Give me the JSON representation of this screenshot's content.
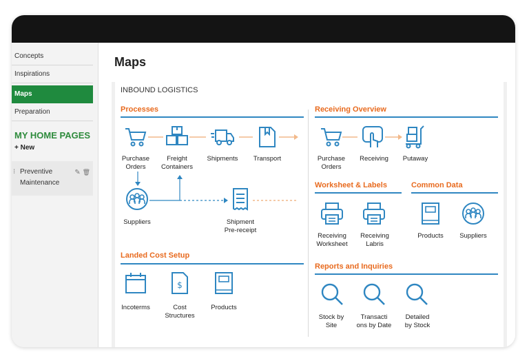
{
  "sidebar": {
    "items": [
      {
        "label": "Concepts"
      },
      {
        "label": "Inspirations"
      },
      {
        "label": "Maps"
      },
      {
        "label": "Preparation"
      }
    ],
    "home_pages_title": "MY HOME PAGES",
    "new_label": "+ New",
    "preferences": [
      {
        "label_line1": "Preventive",
        "label_line2": "Maintenance",
        "icon_glyph": "⁝"
      }
    ],
    "edit_glyph": "✎",
    "delete_glyph": "🗑"
  },
  "main": {
    "title": "Maps",
    "section_title": "INBOUND LOGISTICS",
    "processes": {
      "title": "Processes",
      "items": [
        {
          "label": "Purchase\nOrders",
          "icon": "cart-icon"
        },
        {
          "label": "Freight\nContainers",
          "icon": "containers-icon"
        },
        {
          "label": "Shipments",
          "icon": "truck-icon"
        },
        {
          "label": "Transport",
          "icon": "document-icon"
        },
        {
          "label": "Suppliers",
          "icon": "people-icon"
        },
        {
          "label": "Shipment\nPre-receipt",
          "icon": "receipt-icon"
        }
      ]
    },
    "landed_cost": {
      "title": "Landed Cost Setup",
      "items": [
        {
          "label": "Incoterms",
          "icon": "calendar-icon"
        },
        {
          "label": "Cost\nStructures",
          "icon": "dollar-doc-icon"
        },
        {
          "label": "Products",
          "icon": "book-icon"
        }
      ]
    },
    "receiving": {
      "title": "Receiving Overview",
      "items": [
        {
          "label": "Purchase\nOrders",
          "icon": "cart-icon"
        },
        {
          "label": "Receiving",
          "icon": "tap-icon"
        },
        {
          "label": "Putaway",
          "icon": "trolley-icon"
        }
      ]
    },
    "worksheet": {
      "title": "Worksheet & Labels",
      "items": [
        {
          "label": "Receiving\nWorksheet",
          "icon": "printer-icon"
        },
        {
          "label": "Receiving\nLabris",
          "icon": "printer-icon"
        }
      ]
    },
    "common": {
      "title": "Common Data",
      "items": [
        {
          "label": "Products",
          "icon": "book-icon"
        },
        {
          "label": "Suppliers",
          "icon": "people-icon"
        }
      ]
    },
    "reports": {
      "title": "Reports and Inquiries",
      "items": [
        {
          "label": "Stock by\nSite",
          "icon": "search-icon"
        },
        {
          "label": "Transacti\nons by Date",
          "icon": "search-icon"
        },
        {
          "label": "Detailed\nby Stock",
          "icon": "search-icon"
        }
      ]
    }
  },
  "colors": {
    "accent_green": "#1f8a3e",
    "heading_orange": "#e86a1e",
    "icon_blue": "#2e86c1",
    "topbar": "#141414"
  }
}
